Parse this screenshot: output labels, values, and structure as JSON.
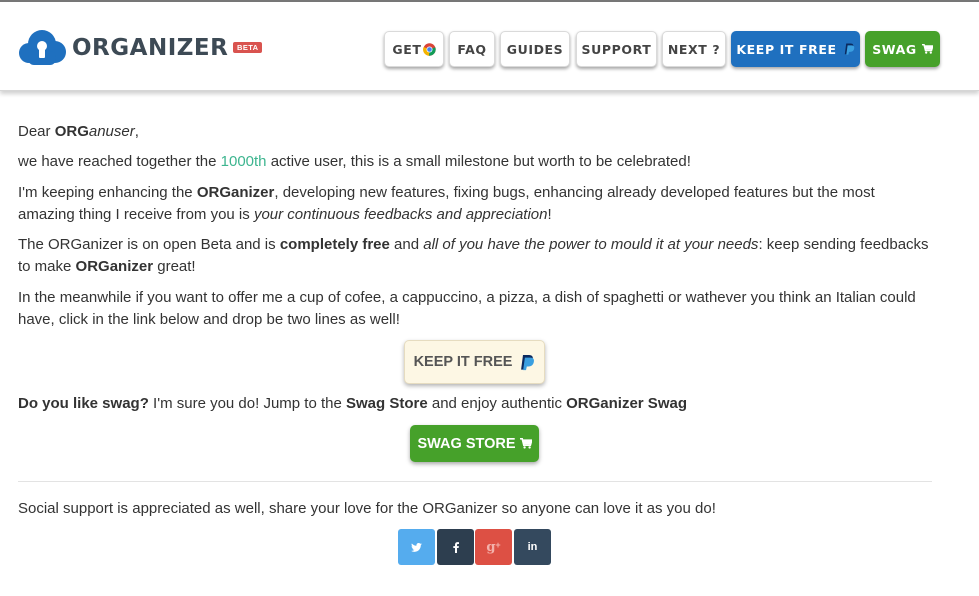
{
  "header": {
    "logo_text": "ORGANIZER",
    "badge": "BETA",
    "nav": [
      {
        "label": "GET",
        "icon": "chrome-icon"
      },
      {
        "label": "FAQ"
      },
      {
        "label": "GUIDES"
      },
      {
        "label": "SUPPORT"
      },
      {
        "label": "NEXT ?"
      },
      {
        "label": "KEEP IT FREE",
        "icon": "paypal-icon"
      },
      {
        "label": "SWAG",
        "icon": "cart-icon"
      }
    ]
  },
  "letter": {
    "greeting_prefix": "Dear ",
    "greeting_bold": "ORG",
    "greeting_italic": "anuser",
    "greeting_suffix": ",",
    "p1_before": "we have reached together the ",
    "p1_highlight": "1000th",
    "p1_after": " active user, this is a small milestone but worth to be celebrated!",
    "p2_before": "I'm keeping enhancing the ",
    "p2_bold": "ORGanizer",
    "p2_middle": ", developing new features, fixing bugs, enhancing already developed features but the most amazing thing I receive from you is ",
    "p2_italic": "your continuous feedbacks and appreciation",
    "p2_after": "!",
    "p3_before": "The ORGanizer is on open Beta and is ",
    "p3_bold": "completely free",
    "p3_middle": " and ",
    "p3_italic": "all of you have the power to mould it at your needs",
    "p3_mid2": ": keep sending feedbacks to make ",
    "p3_bold2": "ORGanizer",
    "p3_after": " great!",
    "p4": "In the meanwhile if you want to offer me a cup of cofee, a cappuccino, a pizza, a dish of spaghetti or wathever you think an Italian could have, click in the link below and drop be two lines as well!",
    "p5_bold1": "Do you like swag?",
    "p5_text1": " I'm sure you do! Jump to the ",
    "p5_bold2": "Swag Store",
    "p5_text2": " and enjoy authentic ",
    "p5_bold3": "ORGanizer Swag",
    "p6": "Social support is appreciated as well, share your love for the ORGanizer so anyone can love it as you do!"
  },
  "buttons": {
    "keep_free": "KEEP IT FREE",
    "swag_store": "SWAG STORE"
  },
  "social": [
    {
      "name": "twitter",
      "icon": "twitter-icon",
      "color": "#55acee"
    },
    {
      "name": "facebook",
      "icon": "facebook-icon",
      "color": "#2d3e4f"
    },
    {
      "name": "google-plus",
      "icon": "google-plus-icon",
      "color": "#dd5044"
    },
    {
      "name": "linkedin",
      "icon": "linkedin-icon",
      "color": "#34495e"
    }
  ],
  "colors": {
    "brand_blue": "#1f70bf",
    "brand_green": "#46a12a",
    "highlight": "#3db58f",
    "beta_badge": "#d9534f"
  }
}
